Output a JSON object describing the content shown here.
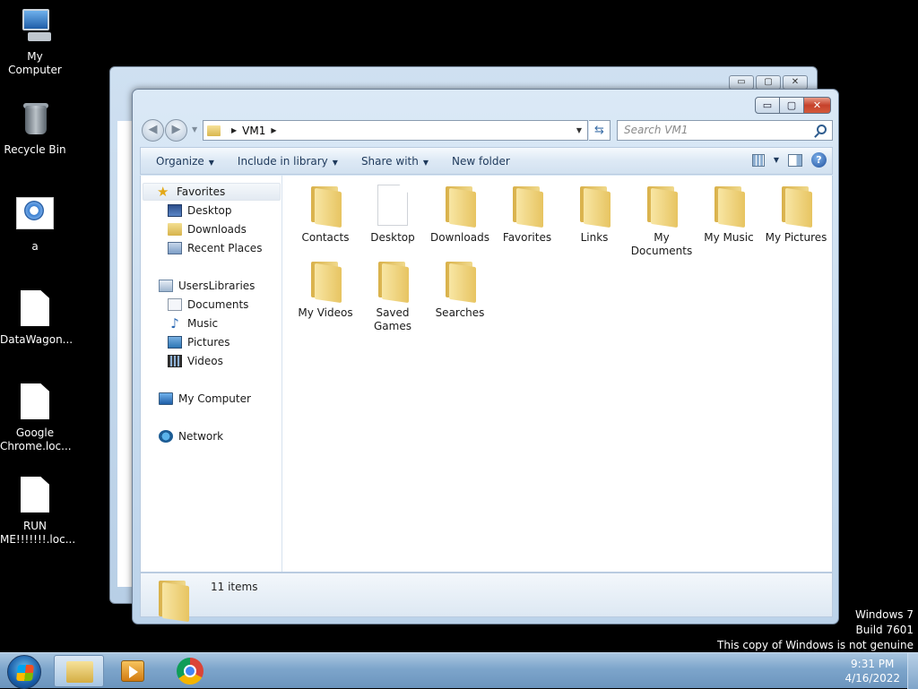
{
  "desktop": {
    "icons": [
      {
        "label": "My Computer",
        "icon": "my-computer-icon"
      },
      {
        "label": "Recycle Bin",
        "icon": "recycle-bin-icon"
      },
      {
        "label": "a",
        "icon": "app-icon"
      },
      {
        "label": "DataWagon...",
        "icon": "file-icon"
      },
      {
        "label": "Google Chrome.loc...",
        "icon": "file-icon"
      },
      {
        "label": "RUN ME!!!!!!!.loc...",
        "icon": "file-icon"
      }
    ]
  },
  "window": {
    "title_buttons": {
      "minimize": "▭",
      "maximize": "▢",
      "close": "✕"
    },
    "address": {
      "crumbs": [
        "VM1"
      ]
    },
    "search": {
      "placeholder": "Search VM1"
    },
    "toolbar": {
      "organize": "Organize",
      "include_in_library": "Include in library",
      "share_with": "Share with",
      "new_folder": "New folder"
    },
    "nav": {
      "favorites": "Favorites",
      "desktop": "Desktop",
      "downloads": "Downloads",
      "recent_places": "Recent Places",
      "libraries": "UsersLibraries",
      "documents": "Documents",
      "music": "Music",
      "pictures": "Pictures",
      "videos": "Videos",
      "my_computer": "My Computer",
      "network": "Network"
    },
    "files": [
      {
        "name": "Contacts",
        "type": "folder"
      },
      {
        "name": "Desktop",
        "type": "blank"
      },
      {
        "name": "Downloads",
        "type": "folder"
      },
      {
        "name": "Favorites",
        "type": "folder"
      },
      {
        "name": "Links",
        "type": "folder"
      },
      {
        "name": "My Documents",
        "type": "folder"
      },
      {
        "name": "My Music",
        "type": "folder"
      },
      {
        "name": "My Pictures",
        "type": "folder"
      },
      {
        "name": "My Videos",
        "type": "folder"
      },
      {
        "name": "Saved Games",
        "type": "folder"
      },
      {
        "name": "Searches",
        "type": "folder"
      }
    ],
    "details": {
      "count": "11 items"
    }
  },
  "watermark": {
    "line1": "Windows 7",
    "line2": "Build 7601",
    "line3": "This copy of Windows is not genuine"
  },
  "taskbar": {
    "clock_time": "9:31 PM",
    "clock_date": "4/16/2022"
  }
}
